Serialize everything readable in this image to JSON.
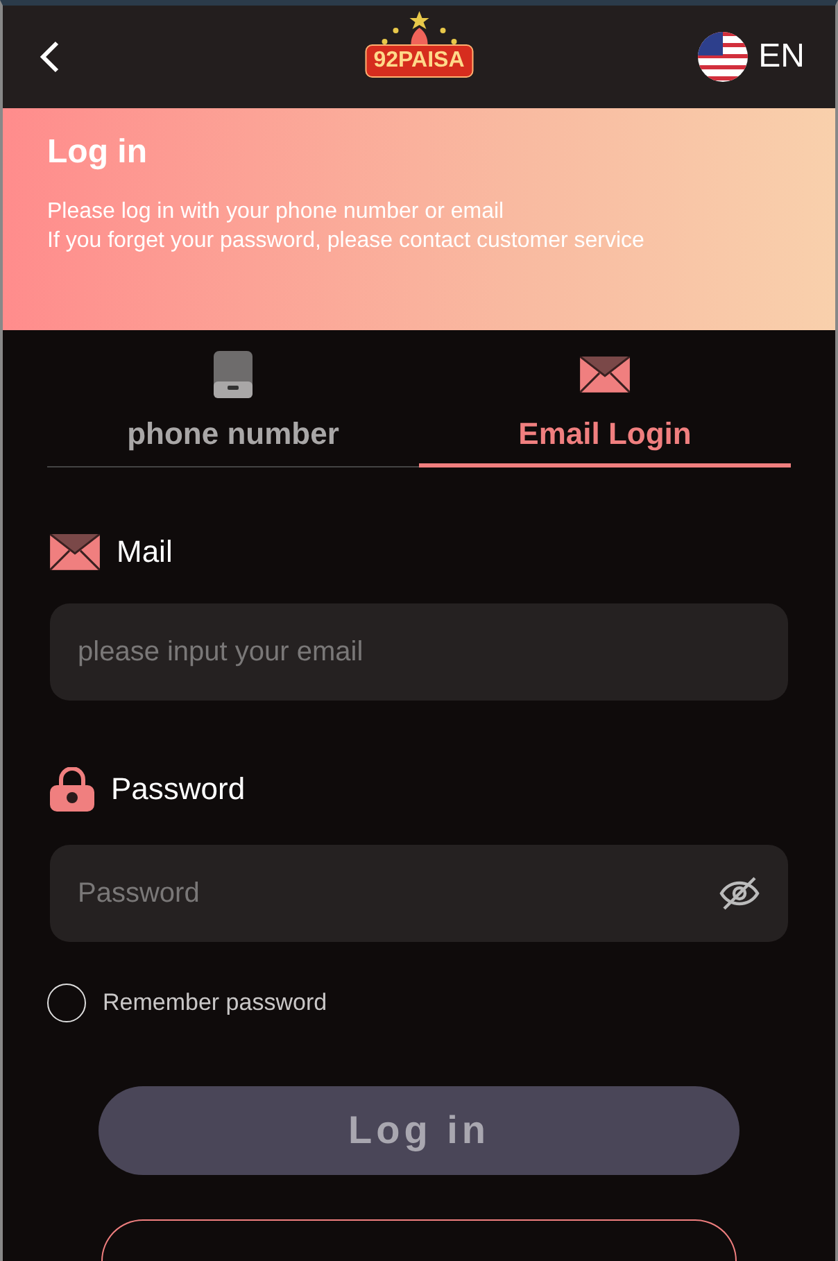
{
  "header": {
    "logo": "92PAISA",
    "language": "EN"
  },
  "banner": {
    "title": "Log in",
    "lines": [
      "Please log in with your phone number or email",
      "If you forget your password, please contact customer service"
    ]
  },
  "tabs": [
    {
      "label": "phone number",
      "kind": "phone",
      "selected": false
    },
    {
      "label": "Email Login",
      "kind": "email",
      "selected": true
    }
  ],
  "fields": [
    {
      "label": "Mail",
      "kind": "email",
      "placeholder": "please input your email"
    },
    {
      "label": "Password",
      "kind": "password",
      "placeholder": "Password"
    }
  ],
  "remember": {
    "label": "Remember password",
    "checked": false
  },
  "login_button": {
    "label": "Log in",
    "disabled": true
  }
}
